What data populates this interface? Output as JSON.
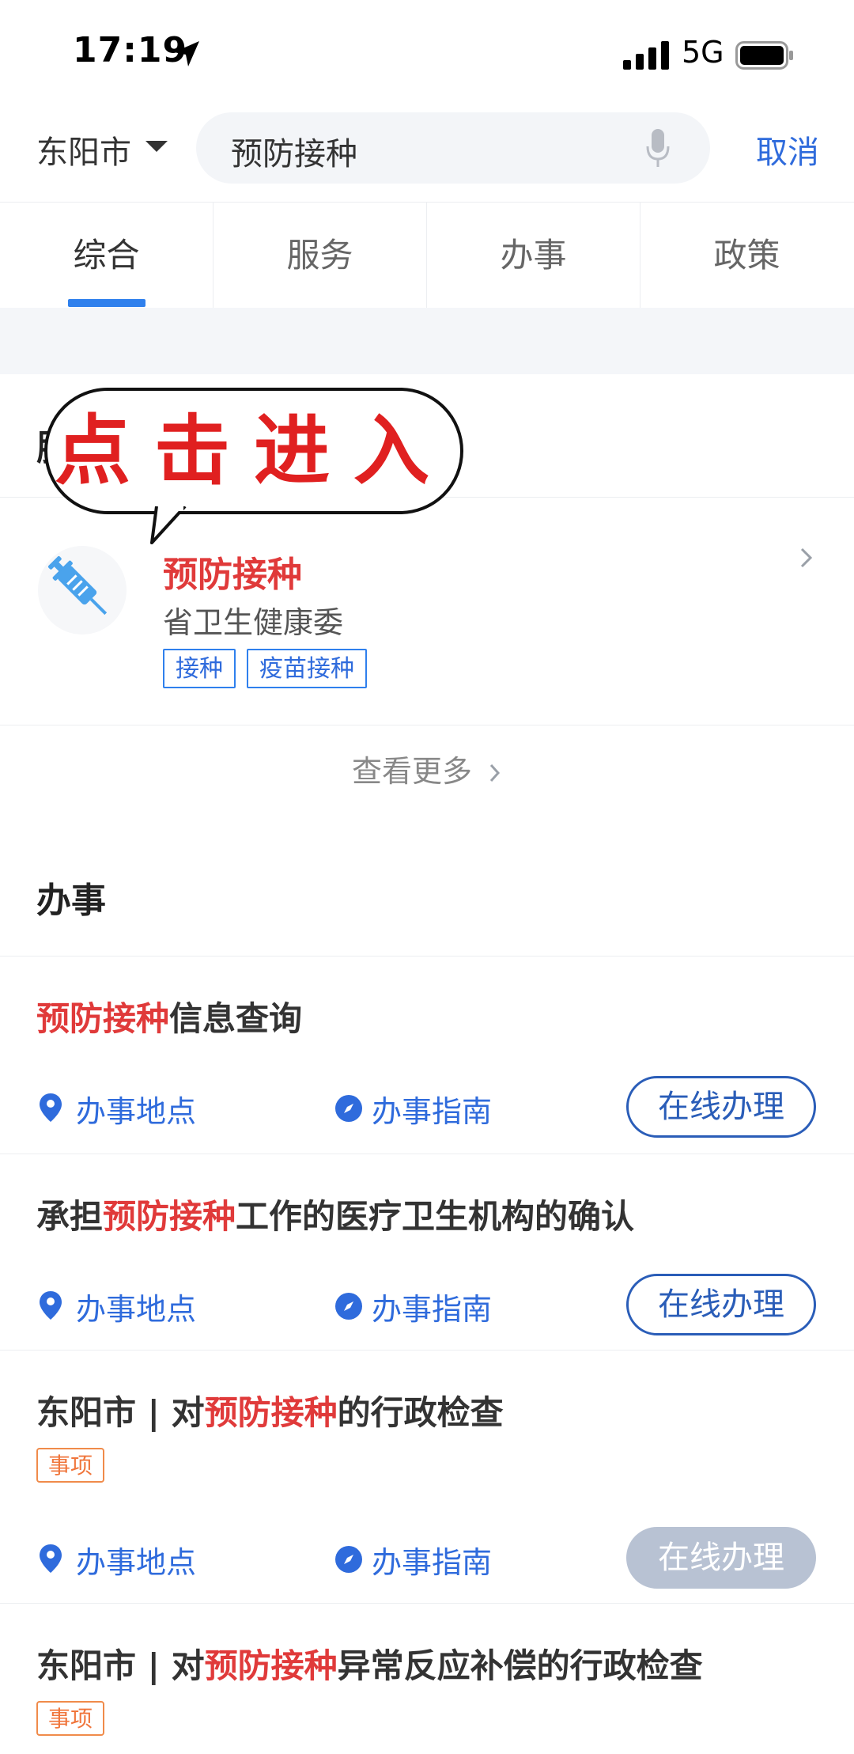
{
  "status_bar": {
    "time": "17:19",
    "network": "5G"
  },
  "header": {
    "city": "东阳市",
    "search_value": "预防接种",
    "cancel_label": "取消"
  },
  "tabs": [
    {
      "label": "综合",
      "active": true
    },
    {
      "label": "服务",
      "active": false
    },
    {
      "label": "办事",
      "active": false
    },
    {
      "label": "政策",
      "active": false
    }
  ],
  "callout": {
    "text": "点击进入"
  },
  "service_section": {
    "title": "服务",
    "item": {
      "name": "预防接种",
      "department": "省卫生健康委",
      "tags": [
        "接种",
        "疫苗接种"
      ]
    },
    "more_label": "查看更多"
  },
  "affairs_section": {
    "title": "办事",
    "actions": {
      "location": "办事地点",
      "guide": "办事指南",
      "online": "在线办理"
    },
    "items": [
      {
        "prefix": "",
        "highlight": "预防接种",
        "suffix": "信息查询",
        "badge": "",
        "online_enabled": true
      },
      {
        "prefix": "承担",
        "highlight": "预防接种",
        "suffix": "工作的医疗卫生机构的确认",
        "badge": "",
        "online_enabled": true
      },
      {
        "prefix": "东阳市 | 对",
        "highlight": "预防接种",
        "suffix": "的行政检查",
        "badge": "事项",
        "online_enabled": false
      },
      {
        "prefix": "东阳市 | 对",
        "highlight": "预防接种",
        "suffix": "异常反应补偿的行政检查",
        "badge": "事项",
        "online_enabled": false
      }
    ]
  },
  "colors": {
    "accent": "#2f6bdc",
    "highlight": "#e03a3a",
    "badge": "#f0763c",
    "disabled": "#b8c2d3"
  }
}
